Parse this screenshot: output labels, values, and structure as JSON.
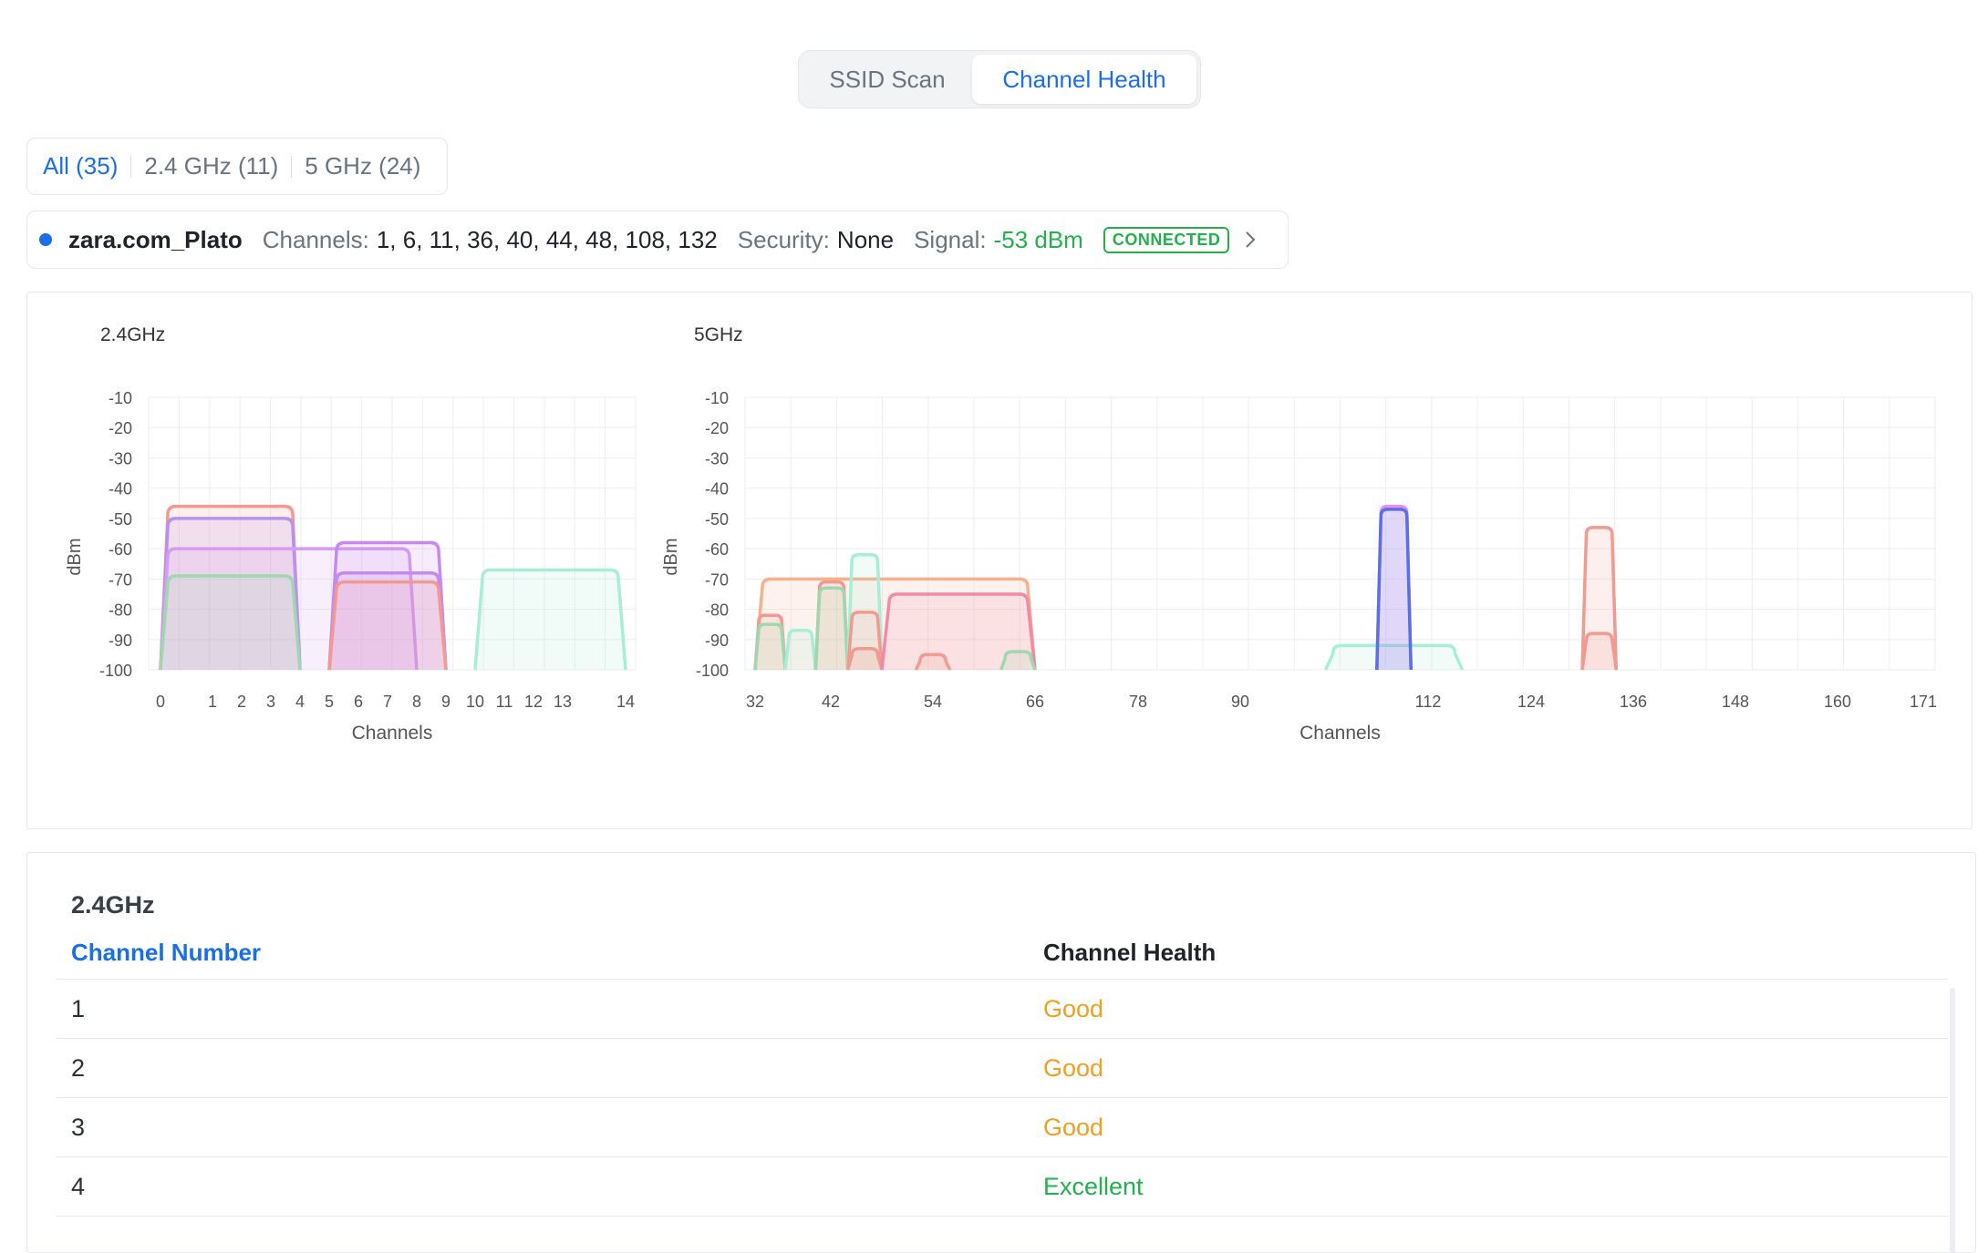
{
  "segmented": {
    "options": [
      "SSID Scan",
      "Channel Health"
    ],
    "active": "Channel Health"
  },
  "filters": [
    {
      "label": "All (35)",
      "active": true
    },
    {
      "label": "2.4 GHz (11)",
      "active": false
    },
    {
      "label": "5 GHz (24)",
      "active": false
    }
  ],
  "connected": {
    "ssid": "zara.com_Plato",
    "channels_label": "Channels:",
    "channels": "1, 6, 11, 36, 40, 44, 48, 108, 132",
    "security_label": "Security:",
    "security": "None",
    "signal_label": "Signal:",
    "signal": "-53 dBm",
    "badge": "CONNECTED",
    "icons": {
      "status": "status-dot-icon",
      "expand": "chevron-right-icon"
    }
  },
  "chart_data": [
    {
      "type": "area",
      "title": "2.4GHz",
      "xlabel": "Channels",
      "ylabel": "dBm",
      "y_ticks": [
        -10,
        -20,
        -30,
        -40,
        -50,
        -60,
        -70,
        -80,
        -90,
        -100
      ],
      "x_ticks": [
        "0",
        "1",
        "2",
        "3",
        "4",
        "5",
        "6",
        "7",
        "8",
        "9",
        "10",
        "11",
        "12",
        "13",
        "14"
      ],
      "ylim": [
        -100,
        -10
      ],
      "grid": true,
      "series": [
        {
          "x_range": [
            0,
            4
          ],
          "y": -46,
          "color": "#f29a8f"
        },
        {
          "x_range": [
            0,
            4
          ],
          "y": -50,
          "color": "#b592f0"
        },
        {
          "x_range": [
            0,
            8
          ],
          "y": -60,
          "color": "#d49cf2"
        },
        {
          "x_range": [
            0,
            4
          ],
          "y": -69,
          "color": "#9fd7b0"
        },
        {
          "x_range": [
            5,
            9
          ],
          "y": -58,
          "color": "#c489f2"
        },
        {
          "x_range": [
            5,
            9
          ],
          "y": -68,
          "color": "#c489f2"
        },
        {
          "x_range": [
            5,
            9
          ],
          "y": -71,
          "color": "#f29a8f"
        },
        {
          "x_range": [
            10,
            14
          ],
          "y": -67,
          "color": "#a6eed8"
        }
      ]
    },
    {
      "type": "area",
      "title": "5GHz",
      "xlabel": "Channels",
      "ylabel": "dBm",
      "y_ticks": [
        -10,
        -20,
        -30,
        -40,
        -50,
        -60,
        -70,
        -80,
        -90,
        -100
      ],
      "x_ticks": [
        "32",
        "42",
        "54",
        "66",
        "78",
        "90",
        "112",
        "124",
        "136",
        "148",
        "160",
        "171"
      ],
      "ylim": [
        -100,
        -10
      ],
      "grid": true,
      "series": [
        {
          "x_range": [
            32,
            66
          ],
          "y": -70,
          "color": "#f5b08c"
        },
        {
          "x_range": [
            32,
            36
          ],
          "y": -82,
          "color": "#f29a8f"
        },
        {
          "x_range": [
            32,
            36
          ],
          "y": -85,
          "color": "#9fd7b0"
        },
        {
          "x_range": [
            36,
            40
          ],
          "y": -87,
          "color": "#a6eed8"
        },
        {
          "x_range": [
            40,
            44
          ],
          "y": -71,
          "color": "#f29a8f"
        },
        {
          "x_range": [
            40,
            44
          ],
          "y": -73,
          "color": "#9fd7b0"
        },
        {
          "x_range": [
            44,
            48
          ],
          "y": -62,
          "color": "#a6eed8"
        },
        {
          "x_range": [
            44,
            48
          ],
          "y": -81,
          "color": "#f29a8f"
        },
        {
          "x_range": [
            44,
            48
          ],
          "y": -93,
          "color": "#f29a8f"
        },
        {
          "x_range": [
            48,
            66
          ],
          "y": -75,
          "color": "#f08aa8"
        },
        {
          "x_range": [
            52,
            56
          ],
          "y": -95,
          "color": "#f29a8f"
        },
        {
          "x_range": [
            62,
            66
          ],
          "y": -94,
          "color": "#9fd7b0"
        },
        {
          "x_range": [
            100,
            116
          ],
          "y": -92,
          "color": "#a6eed8"
        },
        {
          "x_range": [
            106,
            110
          ],
          "y": -46,
          "color": "#ed8bf0"
        },
        {
          "x_range": [
            106,
            110
          ],
          "y": -47,
          "color": "#5a6fe8"
        },
        {
          "x_range": [
            130,
            134
          ],
          "y": -53,
          "color": "#f29a8f"
        },
        {
          "x_range": [
            130,
            134
          ],
          "y": -88,
          "color": "#f29a8f"
        }
      ]
    }
  ],
  "table": {
    "title": "2.4GHz",
    "columns": [
      "Channel Number",
      "Channel Health"
    ],
    "rows": [
      {
        "channel": "1",
        "health": "Good"
      },
      {
        "channel": "2",
        "health": "Good"
      },
      {
        "channel": "3",
        "health": "Good"
      },
      {
        "channel": "4",
        "health": "Excellent"
      }
    ]
  },
  "colors": {
    "accent": "#1a6fe8",
    "good": "#f0a020",
    "excellent": "#22b14c"
  }
}
